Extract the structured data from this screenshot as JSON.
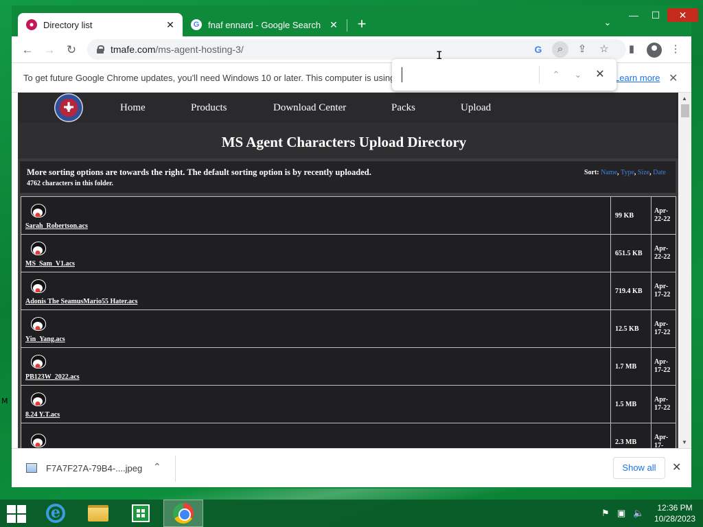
{
  "browser": {
    "tabs": [
      {
        "title": "Directory list",
        "favicon": "site-favicon-icon",
        "active": true
      },
      {
        "title": "fnaf ennard - Google Search",
        "favicon": "google-favicon-icon",
        "active": false
      }
    ],
    "url_host": "tmafe.com",
    "url_path": "/ms-agent-hosting-3/",
    "google_letter": "G",
    "infobar": {
      "text": "To get future Google Chrome updates, you'll need Windows 10 or later. This computer is using Windows 8.",
      "link": "Learn more"
    },
    "find": {
      "query": "",
      "placeholder": ""
    }
  },
  "site": {
    "nav": [
      "Home",
      "Products",
      "Download Center",
      "Packs",
      "Upload"
    ],
    "title": "MS Agent Characters Upload Directory",
    "info": "More sorting options are towards the right. The default sorting option is by recently uploaded.",
    "count": "4762 characters in this folder.",
    "sort_label": "Sort:",
    "sort_options": [
      "Name",
      "Type",
      "Size",
      "Date"
    ],
    "files": [
      {
        "name": "Sarah_Robertson.acs",
        "size": "99 KB",
        "date": "Apr-22-22"
      },
      {
        "name": "MS_Sam_V1.acs",
        "size": "651.5 KB",
        "date": "Apr-22-22"
      },
      {
        "name": "Adonis The SeamusMario55 Hater.acs",
        "size": "719.4 KB",
        "date": "Apr-17-22"
      },
      {
        "name": "Yin_Yang.acs",
        "size": "12.5 KB",
        "date": "Apr-17-22"
      },
      {
        "name": "PB123W_2022.acs",
        "size": "1.7 MB",
        "date": "Apr-17-22"
      },
      {
        "name": "8.24 Y.T.acs",
        "size": "1.5 MB",
        "date": "Apr-17-22"
      },
      {
        "name": "",
        "size": "2.3 MB",
        "date": "Apr-17-"
      }
    ]
  },
  "download": {
    "filename": "F7A7F27A-79B4-....jpeg",
    "show_all": "Show all"
  },
  "taskbar": {
    "time": "12:36 PM",
    "date": "10/28/2023"
  },
  "desktop_letter": "M",
  "colors": {
    "accent_link": "#1a73e8",
    "site_bg": "#3b3b3d",
    "sort_link": "#3e7fe0"
  }
}
